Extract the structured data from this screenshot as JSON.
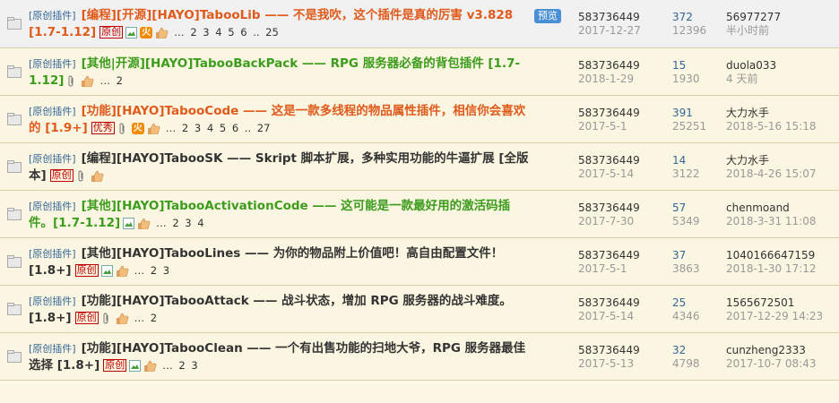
{
  "threads": [
    {
      "category": "[原创插件]",
      "title": "[编程][开源][HAYO]TabooLib —— 不是我吹，这个插件是真的厉害 v3.828 [1.7-1.12]",
      "title_color": "orange",
      "badges": [
        "原创"
      ],
      "extra": [
        "image",
        "fire",
        "like"
      ],
      "pages": "… 2 3 4 5 6 .. 25",
      "preview_label": "预览",
      "author": "583736449",
      "date": "2017-12-27",
      "replies": "372",
      "views": "12396",
      "last_user": "56977277",
      "last_time": "半小时前"
    },
    {
      "category": "[原创插件]",
      "title": "[其他|开源][HAYO]TabooBackPack —— RPG 服务器必备的背包插件 [1.7-1.12]",
      "title_color": "green",
      "badges": [],
      "extra": [
        "attach",
        "like"
      ],
      "pages": "… 2",
      "author": "583736449",
      "date": "2018-1-29",
      "replies": "15",
      "views": "1930",
      "last_user": "duola033",
      "last_time": "4 天前"
    },
    {
      "category": "[原创插件]",
      "title": "[功能][HAYO]TabooCode —— 这是一款多线程的物品属性插件，相信你会喜欢的 [1.9+]",
      "title_color": "orange",
      "badges": [
        "优秀"
      ],
      "extra": [
        "attach",
        "fire",
        "like"
      ],
      "pages": "… 2 3 4 5 6 .. 27",
      "author": "583736449",
      "date": "2017-5-1",
      "replies": "391",
      "views": "25251",
      "last_user": "大力水手",
      "last_time": "2018-5-16 15:18"
    },
    {
      "category": "[原创插件]",
      "title": "[编程][HAYO]TabooSK —— Skript 脚本扩展，多种实用功能的牛逼扩展 [全版本]",
      "title_color": "dark",
      "badges": [
        "原创"
      ],
      "extra": [
        "attach",
        "like"
      ],
      "pages": "",
      "author": "583736449",
      "date": "2017-5-14",
      "replies": "14",
      "views": "3122",
      "last_user": "大力水手",
      "last_time": "2018-4-26 15:07"
    },
    {
      "category": "[原创插件]",
      "title": "[其他][HAYO]TabooActivationCode —— 这可能是一款最好用的激活码插件。[1.7-1.12]",
      "title_color": "green",
      "badges": [],
      "extra": [
        "image",
        "like"
      ],
      "pages": "… 2 3 4",
      "author": "583736449",
      "date": "2017-7-30",
      "replies": "57",
      "views": "5349",
      "last_user": "chenmoand",
      "last_time": "2018-3-31 11:08"
    },
    {
      "category": "[原创插件]",
      "title": "[其他][HAYO]TabooLines —— 为你的物品附上价值吧！高自由配置文件！[1.8+]",
      "title_color": "dark",
      "badges": [
        "原创"
      ],
      "extra": [
        "image",
        "like"
      ],
      "pages": "… 2 3",
      "author": "583736449",
      "date": "2017-5-1",
      "replies": "37",
      "views": "3863",
      "last_user": "1040166647159",
      "last_time": "2018-1-30 17:12"
    },
    {
      "category": "[原创插件]",
      "title": "[功能][HAYO]TabooAttack —— 战斗状态，增加 RPG 服务器的战斗难度。[1.8+]",
      "title_color": "dark",
      "badges": [
        "原创"
      ],
      "extra": [
        "attach",
        "like"
      ],
      "pages": "… 2",
      "author": "583736449",
      "date": "2017-5-14",
      "replies": "25",
      "views": "4346",
      "last_user": "1565672501",
      "last_time": "2017-12-29 14:23"
    },
    {
      "category": "[原创插件]",
      "title": "[功能][HAYO]TabooClean —— 一个有出售功能的扫地大爷，RPG 服务器最佳选择 [1.8+]",
      "title_color": "dark",
      "badges": [
        "原创"
      ],
      "extra": [
        "image",
        "like"
      ],
      "pages": "… 2 3",
      "author": "583736449",
      "date": "2017-5-13",
      "replies": "32",
      "views": "4798",
      "last_user": "cunzheng2333",
      "last_time": "2017-10-7 08:43"
    }
  ]
}
